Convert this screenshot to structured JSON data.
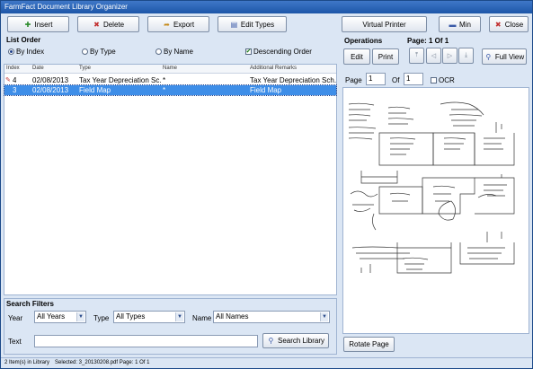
{
  "window": {
    "title": "FarmFact Document Library Organizer"
  },
  "toolbar": {
    "insert": "Insert",
    "delete": "Delete",
    "export": "Export",
    "edit_types": "Edit Types",
    "virtual_printer": "Virtual Printer",
    "min": "Min",
    "close": "Close"
  },
  "list_order": {
    "title": "List Order",
    "by_index": "By Index",
    "by_type": "By Type",
    "by_name": "By Name",
    "descending": "Descending Order",
    "selected": "By Index",
    "descending_checked": true
  },
  "grid": {
    "columns": [
      "Index",
      "Date",
      "Type",
      "Name",
      "Additional Remarks"
    ],
    "rows": [
      {
        "index": "4",
        "date": "02/08/2013",
        "type": "Tax Year Depreciation Sc...",
        "name": "*",
        "remarks": "Tax Year Depreciation Sch...",
        "selected": false
      },
      {
        "index": "3",
        "date": "02/08/2013",
        "type": "Field Map",
        "name": "*",
        "remarks": "Field Map",
        "selected": true
      }
    ]
  },
  "search_filters": {
    "title": "Search Filters",
    "year_label": "Year",
    "year_value": "All Years",
    "type_label": "Type",
    "type_value": "All Types",
    "name_label": "Name",
    "name_value": "All Names",
    "text_label": "Text",
    "text_value": "",
    "search_button": "Search Library"
  },
  "operations": {
    "title": "Operations",
    "edit": "Edit",
    "print": "Print"
  },
  "page_nav": {
    "title": "Page: 1 Of 1",
    "full_view": "Full View",
    "page_label": "Page",
    "page_value": "1",
    "of_label": "Of",
    "of_value": "1",
    "ocr": "OCR",
    "rotate": "Rotate Page"
  },
  "status": {
    "count": "2 Item(s) in Library",
    "selected": "Selected: 3_20130208.pdf  Page: 1 Of 1"
  }
}
